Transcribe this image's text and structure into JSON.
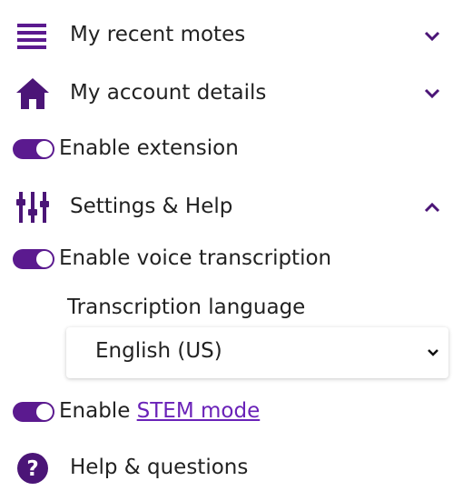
{
  "colors": {
    "accent": "#5b1a8f",
    "link": "#6a22b8",
    "text": "#222222"
  },
  "items": {
    "recent": {
      "label": "My recent motes",
      "icon": "menu-lines-icon",
      "expanded": false
    },
    "account": {
      "label": "My account details",
      "icon": "home-icon",
      "expanded": false
    },
    "settings": {
      "label": "Settings & Help",
      "icon": "sliders-icon",
      "expanded": true
    },
    "help": {
      "label": "Help & questions",
      "icon": "question-circle-icon"
    }
  },
  "toggles": {
    "extension": {
      "label": "Enable extension",
      "on": true
    },
    "voice": {
      "label": "Enable voice transcription",
      "on": true
    },
    "stem": {
      "label_prefix": "Enable ",
      "link_text": "STEM mode",
      "on": true
    }
  },
  "transcription": {
    "label": "Transcription language",
    "selected": "English (US)"
  }
}
